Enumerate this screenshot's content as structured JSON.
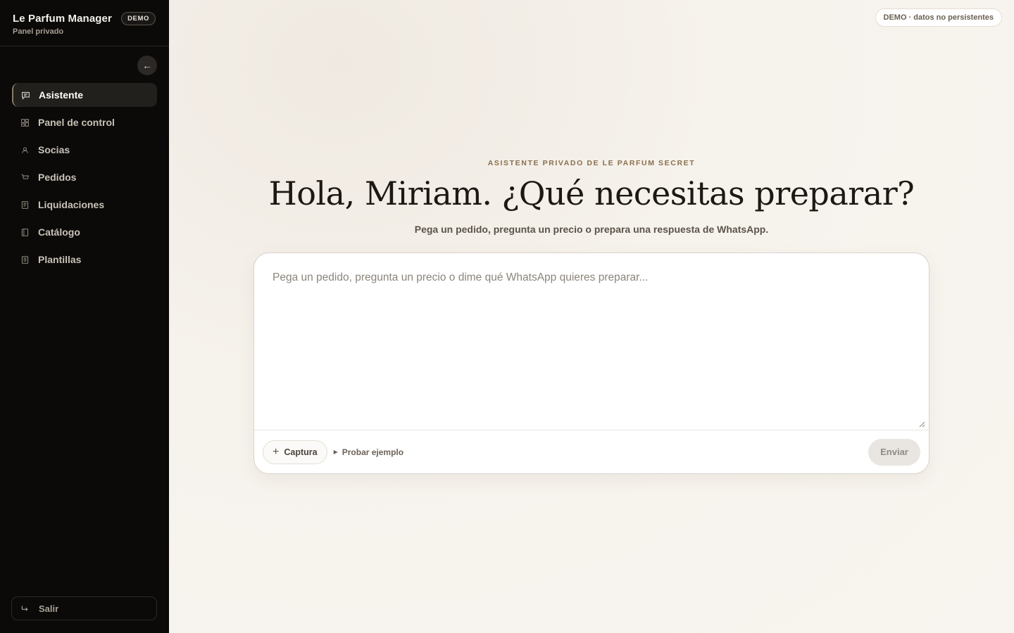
{
  "sidebar": {
    "brand_title": "Le Parfum Manager",
    "brand_badge": "DEMO",
    "brand_sub": "Panel privado",
    "collapse_icon": "arrow-left-icon",
    "items": [
      {
        "label": "Asistente",
        "icon": "chat-icon",
        "active": true
      },
      {
        "label": "Panel de control",
        "icon": "dashboard-icon",
        "active": false
      },
      {
        "label": "Socias",
        "icon": "user-icon",
        "active": false
      },
      {
        "label": "Pedidos",
        "icon": "cart-icon",
        "active": false
      },
      {
        "label": "Liquidaciones",
        "icon": "receipt-icon",
        "active": false
      },
      {
        "label": "Catálogo",
        "icon": "book-icon",
        "active": false
      },
      {
        "label": "Plantillas",
        "icon": "document-icon",
        "active": false
      }
    ],
    "logout_label": "Salir"
  },
  "header": {
    "demo_pill": "DEMO · datos no persistentes"
  },
  "main": {
    "eyebrow": "ASISTENTE PRIVADO DE LE PARFUM SECRET",
    "headline": "Hola, Miriam. ¿Qué necesitas preparar?",
    "subline": "Pega un pedido, pregunta un precio o prepara una respuesta de WhatsApp."
  },
  "composer": {
    "placeholder": "Pega un pedido, pregunta un precio o dime qué WhatsApp quieres preparar...",
    "value": "",
    "capture_label": "Captura",
    "example_label": "Probar ejemplo",
    "send_label": "Enviar"
  },
  "colors": {
    "sidebar_bg": "#0b0a09",
    "accent": "#8a6f4e",
    "background": "#f7f3ee"
  }
}
